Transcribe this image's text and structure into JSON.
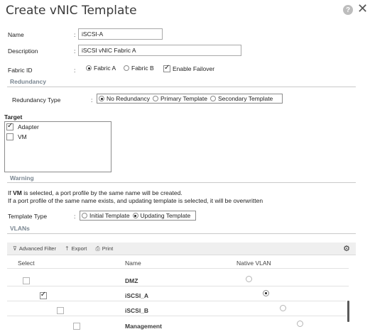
{
  "dialog": {
    "title": "Create vNIC Template",
    "help_label": "?",
    "close_label": "✕"
  },
  "form": {
    "name_label": "Name",
    "name_value": "iSCSI-A",
    "description_label": "Description",
    "description_value": "iSCSI vNIC Fabric A",
    "colon": ":",
    "fabric_label": "Fabric ID",
    "fabric_a": "Fabric A",
    "fabric_b": "Fabric B",
    "fabric_selected": "Fabric A",
    "enable_failover": "Enable Failover",
    "enable_failover_checked": true
  },
  "redundancy": {
    "section_title": "Redundancy",
    "type_label": "Redundancy Type",
    "options": [
      "No Redundancy",
      "Primary Template",
      "Secondary Template"
    ],
    "selected": "No Redundancy"
  },
  "target": {
    "label": "Target",
    "items": [
      {
        "label": "Adapter",
        "checked": true
      },
      {
        "label": "VM",
        "checked": false
      }
    ]
  },
  "warning": {
    "section_title": "Warning",
    "line1_prefix": "If ",
    "line1_bold": "VM",
    "line1_suffix": " is selected, a port profile by the same name will be created.",
    "line2": "If a port profile of the same name exists, and updating template is selected, it will be overwritten"
  },
  "template_type": {
    "label": "Template Type",
    "options": [
      "Initial Template",
      "Updating Template"
    ],
    "selected": "Updating Template"
  },
  "vlans": {
    "section_title": "VLANs",
    "toolbar": {
      "advanced_filter": "Advanced Filter",
      "export": "Export",
      "print": "Print"
    },
    "columns": {
      "select": "Select",
      "name": "Name",
      "native": "Native VLAN"
    },
    "rows": [
      {
        "name": "DMZ",
        "selected": false,
        "native": false
      },
      {
        "name": "iSCSI_A",
        "selected": true,
        "native": true
      },
      {
        "name": "iSCSI_B",
        "selected": false,
        "native": false
      },
      {
        "name": "Management",
        "selected": false,
        "native": false
      }
    ]
  },
  "icons": {
    "filter": "filter-icon",
    "export": "export-arrow-icon",
    "print": "printer-icon",
    "settings": "gear-icon"
  }
}
